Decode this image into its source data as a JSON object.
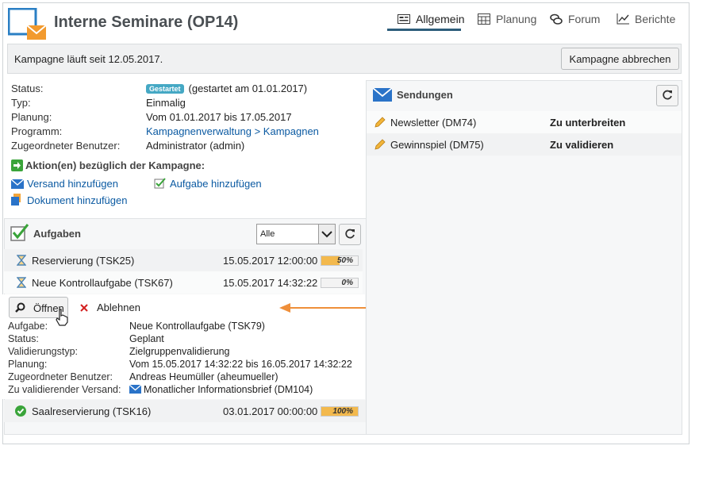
{
  "header": {
    "title": "Interne Seminare (OP14)",
    "tabs": [
      {
        "label": "Allgemein",
        "icon": "general-icon",
        "active": true
      },
      {
        "label": "Planung",
        "icon": "calendar-icon",
        "active": false
      },
      {
        "label": "Forum",
        "icon": "forum-icon",
        "active": false
      },
      {
        "label": "Berichte",
        "icon": "chart-icon",
        "active": false
      }
    ]
  },
  "banner": {
    "text": "Kampagne läuft seit 12.05.2017.",
    "stop_label": "Kampagne abbrechen"
  },
  "info": {
    "status_label": "Status:",
    "status_badge": "Gestartet",
    "status_value": "(gestartet am 01.01.2017)",
    "type_label": "Typ:",
    "type_value": "Einmalig",
    "planning_label": "Planung:",
    "planning_value": "Vom 01.01.2017 bis 17.05.2017",
    "program_label": "Programm:",
    "program_value": "Kampagnenverwaltung > Kampagnen",
    "user_label": "Zugeordneter Benutzer:",
    "user_value": "Administrator (admin)"
  },
  "actions": {
    "title": "Aktion(en) bezüglich der Kampagne:",
    "add_delivery": "Versand hinzufügen",
    "add_task": "Aufgabe hinzufügen",
    "add_document": "Dokument hinzufügen"
  },
  "tasks": {
    "title": "Aufgaben",
    "filter_value": "Alle",
    "rows": [
      {
        "name": "Reservierung (TSK25)",
        "date": "15.05.2017 12:00:00",
        "progress_label": "50%",
        "progress": 0.5,
        "icon": "hourglass-icon"
      },
      {
        "name": "Neue Kontrollaufgabe (TSK67)",
        "date": "15.05.2017 14:32:22",
        "progress_label": "0%",
        "progress": 0.0,
        "icon": "hourglass-icon"
      }
    ],
    "open_label": "Öffnen",
    "reject_label": "Ablehnen",
    "details": {
      "task_label": "Aufgabe:",
      "task_value": "Neue Kontrollaufgabe (TSK79)",
      "status_label": "Status:",
      "status_value": "Geplant",
      "validation_label": "Validierungstyp:",
      "validation_value": "Zielgruppenvalidierung",
      "planning_label": "Planung:",
      "planning_value": "Vom 15.05.2017 14:32:22 bis 16.05.2017 14:32:22",
      "user_label": "Zugeordneter Benutzer:",
      "user_value": "Andreas Heumüller (aheumueller)",
      "delivery_label": "Zu validierender Versand:",
      "delivery_value": "Monatlicher Informationsbrief (DM104)"
    },
    "last_row": {
      "name": "Saalreservierung (TSK16)",
      "date": "03.01.2017 00:00:00",
      "progress_label": "100%",
      "progress": 1.0,
      "icon": "check-icon"
    }
  },
  "deliveries": {
    "title": "Sendungen",
    "rows": [
      {
        "name": "Newsletter (DM74)",
        "status": "Zu unterbreiten",
        "icon": "pencil-icon"
      },
      {
        "name": "Gewinnspiel (DM75)",
        "status": "Zu validieren",
        "icon": "pencil-icon"
      }
    ]
  },
  "colors": {
    "accent": "#2d5d7b",
    "link": "#0b5aa2",
    "badge": "#45a8c4",
    "progress": "#f3b94d",
    "arrow": "#ef8f3a"
  }
}
